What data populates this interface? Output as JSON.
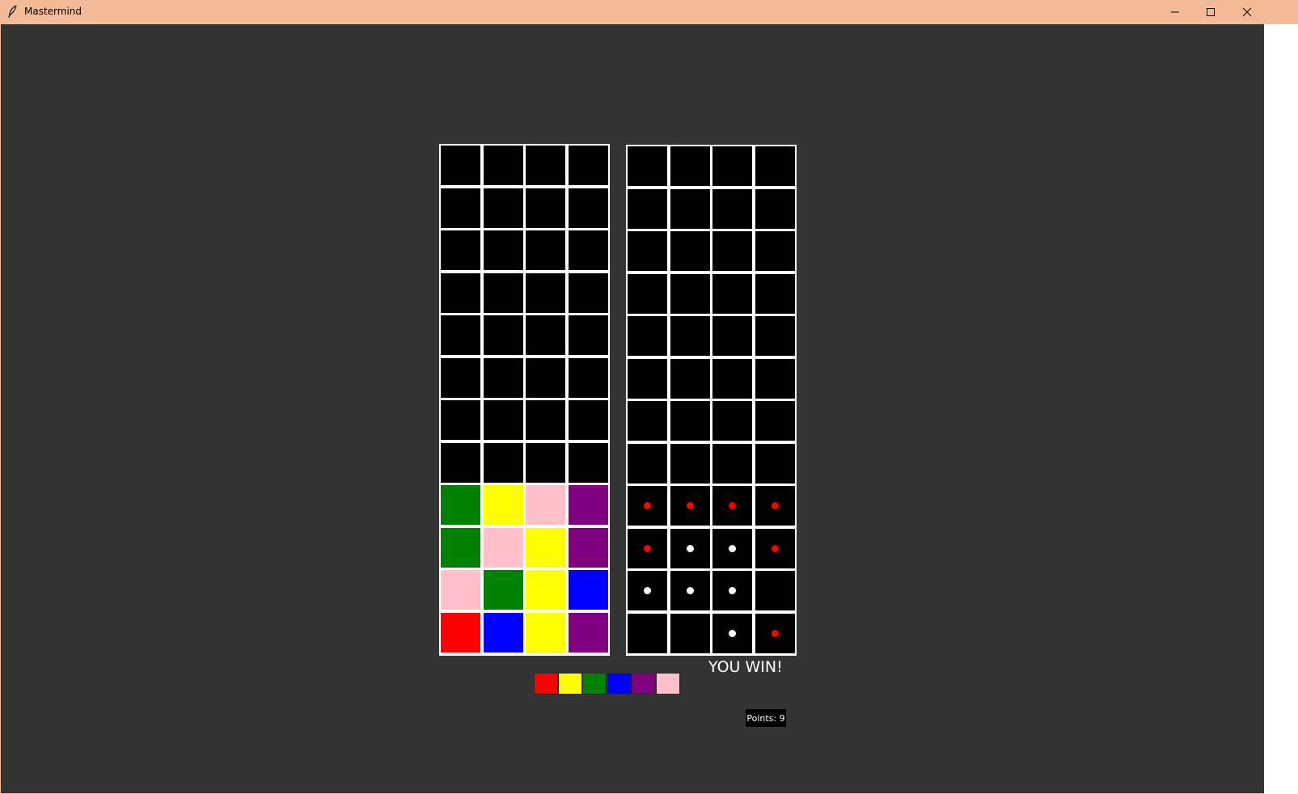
{
  "window": {
    "title": "Mastermind",
    "icon": "feather-icon",
    "controls": [
      "minimize-icon",
      "maximize-icon",
      "close-icon"
    ]
  },
  "colors": {
    "red": "#ff0000",
    "yellow": "#ffff00",
    "green": "#008000",
    "blue": "#0000ff",
    "purple": "#800080",
    "pink": "#ffc0cb",
    "empty": "#000000",
    "background": "#343434",
    "feedback_exact": "#ff0000",
    "feedback_color": "#ffffff"
  },
  "guess_board": [
    [
      "empty",
      "empty",
      "empty",
      "empty"
    ],
    [
      "empty",
      "empty",
      "empty",
      "empty"
    ],
    [
      "empty",
      "empty",
      "empty",
      "empty"
    ],
    [
      "empty",
      "empty",
      "empty",
      "empty"
    ],
    [
      "empty",
      "empty",
      "empty",
      "empty"
    ],
    [
      "empty",
      "empty",
      "empty",
      "empty"
    ],
    [
      "empty",
      "empty",
      "empty",
      "empty"
    ],
    [
      "empty",
      "empty",
      "empty",
      "empty"
    ],
    [
      "green",
      "yellow",
      "pink",
      "purple"
    ],
    [
      "green",
      "pink",
      "yellow",
      "purple"
    ],
    [
      "pink",
      "green",
      "yellow",
      "blue"
    ],
    [
      "red",
      "blue",
      "yellow",
      "purple"
    ]
  ],
  "feedback_board": [
    [
      "",
      "",
      "",
      ""
    ],
    [
      "",
      "",
      "",
      ""
    ],
    [
      "",
      "",
      "",
      ""
    ],
    [
      "",
      "",
      "",
      ""
    ],
    [
      "",
      "",
      "",
      ""
    ],
    [
      "",
      "",
      "",
      ""
    ],
    [
      "",
      "",
      "",
      ""
    ],
    [
      "",
      "",
      "",
      ""
    ],
    [
      "red",
      "red",
      "red",
      "red"
    ],
    [
      "red",
      "white",
      "white",
      "red"
    ],
    [
      "white",
      "white",
      "white",
      ""
    ],
    [
      "",
      "",
      "white",
      "red"
    ]
  ],
  "palette": [
    "red",
    "yellow",
    "green",
    "blue",
    "purple",
    "pink"
  ],
  "status": {
    "result": "YOU WIN!",
    "points_label": "Points: 9"
  }
}
